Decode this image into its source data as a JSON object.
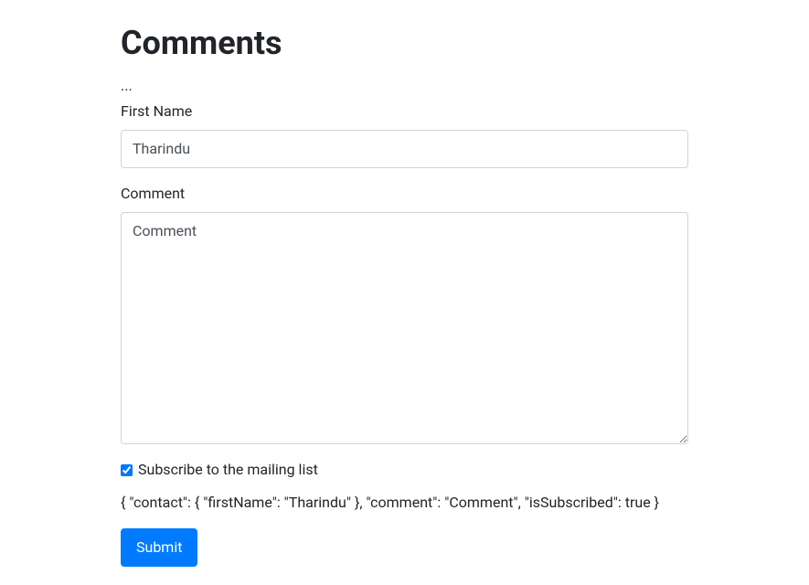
{
  "page": {
    "title": "Comments",
    "ellipsis": "..."
  },
  "form": {
    "firstName": {
      "label": "First Name",
      "value": "Tharindu"
    },
    "comment": {
      "label": "Comment",
      "value": "Comment"
    },
    "subscribe": {
      "label": "Subscribe to the mailing list",
      "checked": true
    },
    "debug": "{ \"contact\": { \"firstName\": \"Tharindu\" }, \"comment\": \"Comment\", \"isSubscribed\": true }",
    "submit": {
      "label": "Submit"
    }
  }
}
